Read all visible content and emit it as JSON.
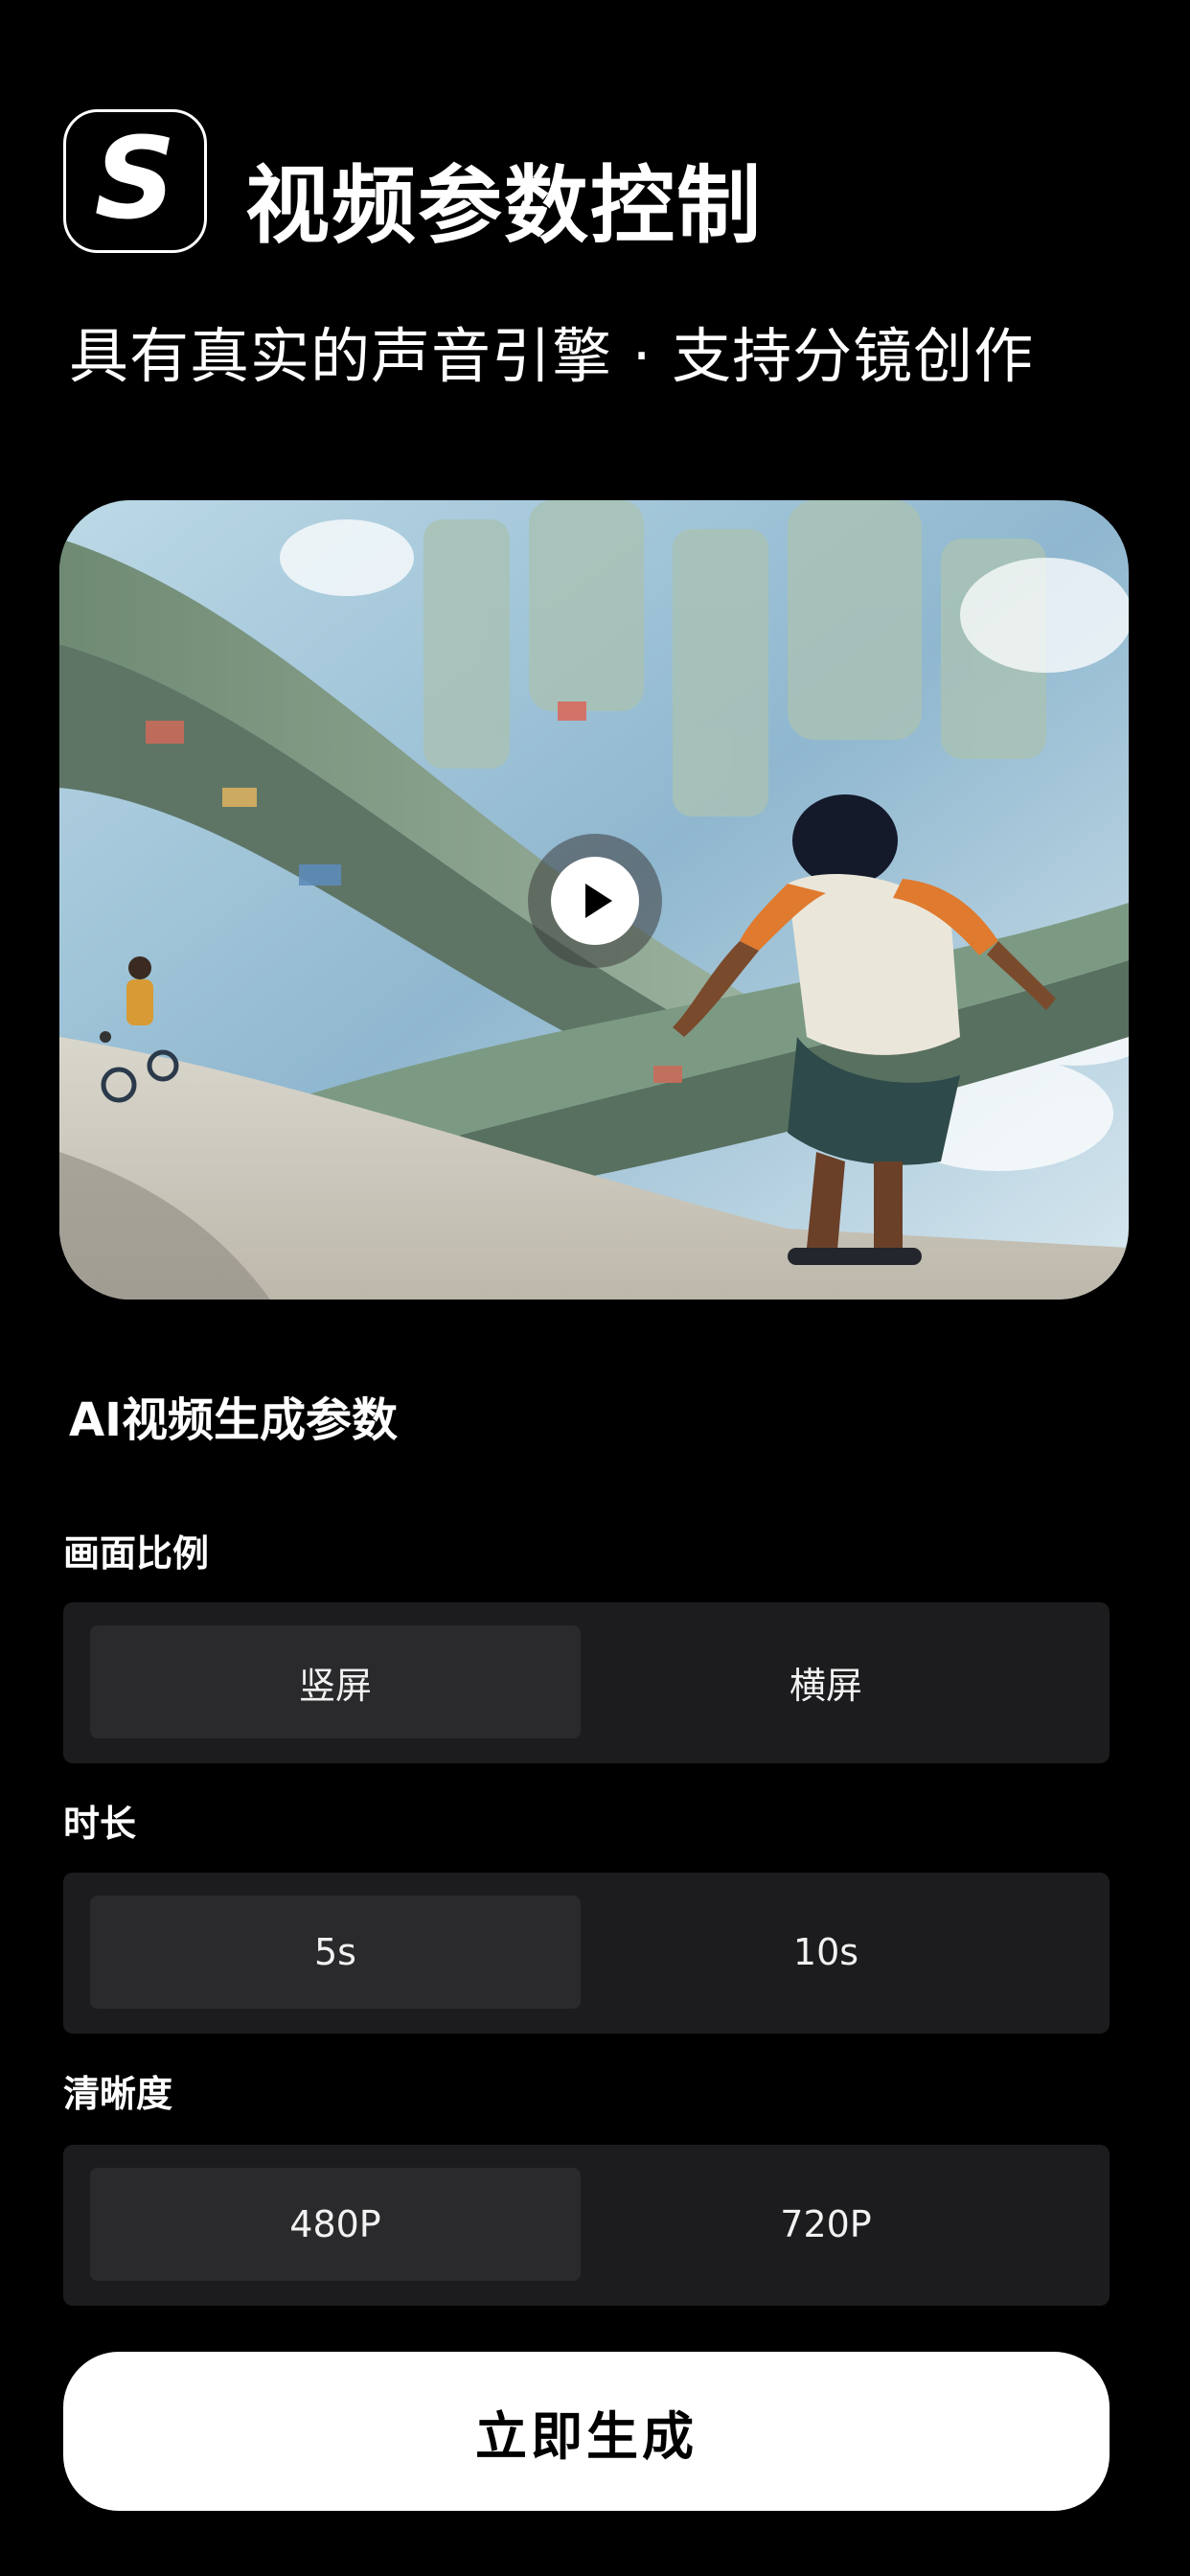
{
  "header": {
    "logo_letter": "S",
    "title": "视频参数控制",
    "subtitle": "具有真实的声音引擎 · 支持分镜创作"
  },
  "video": {
    "preview": "anime-style city with curved roads, skateboarder and cyclist",
    "play_icon": "play-icon"
  },
  "params": {
    "section_title": "AI视频生成参数",
    "aspect": {
      "label": "画面比例",
      "options": [
        "竖屏",
        "横屏"
      ],
      "selected": "竖屏"
    },
    "duration": {
      "label": "时长",
      "options": [
        "5s",
        "10s"
      ],
      "selected": "5s"
    },
    "resolution": {
      "label": "清晰度",
      "options": [
        "480P",
        "720P"
      ],
      "selected": "480P"
    }
  },
  "actions": {
    "generate_label": "立即生成"
  },
  "colors": {
    "background": "#000000",
    "segment_bg": "#1c1c1e",
    "segment_selected": "#2a2a2c",
    "button_bg": "#ffffff",
    "button_text": "#000000"
  }
}
